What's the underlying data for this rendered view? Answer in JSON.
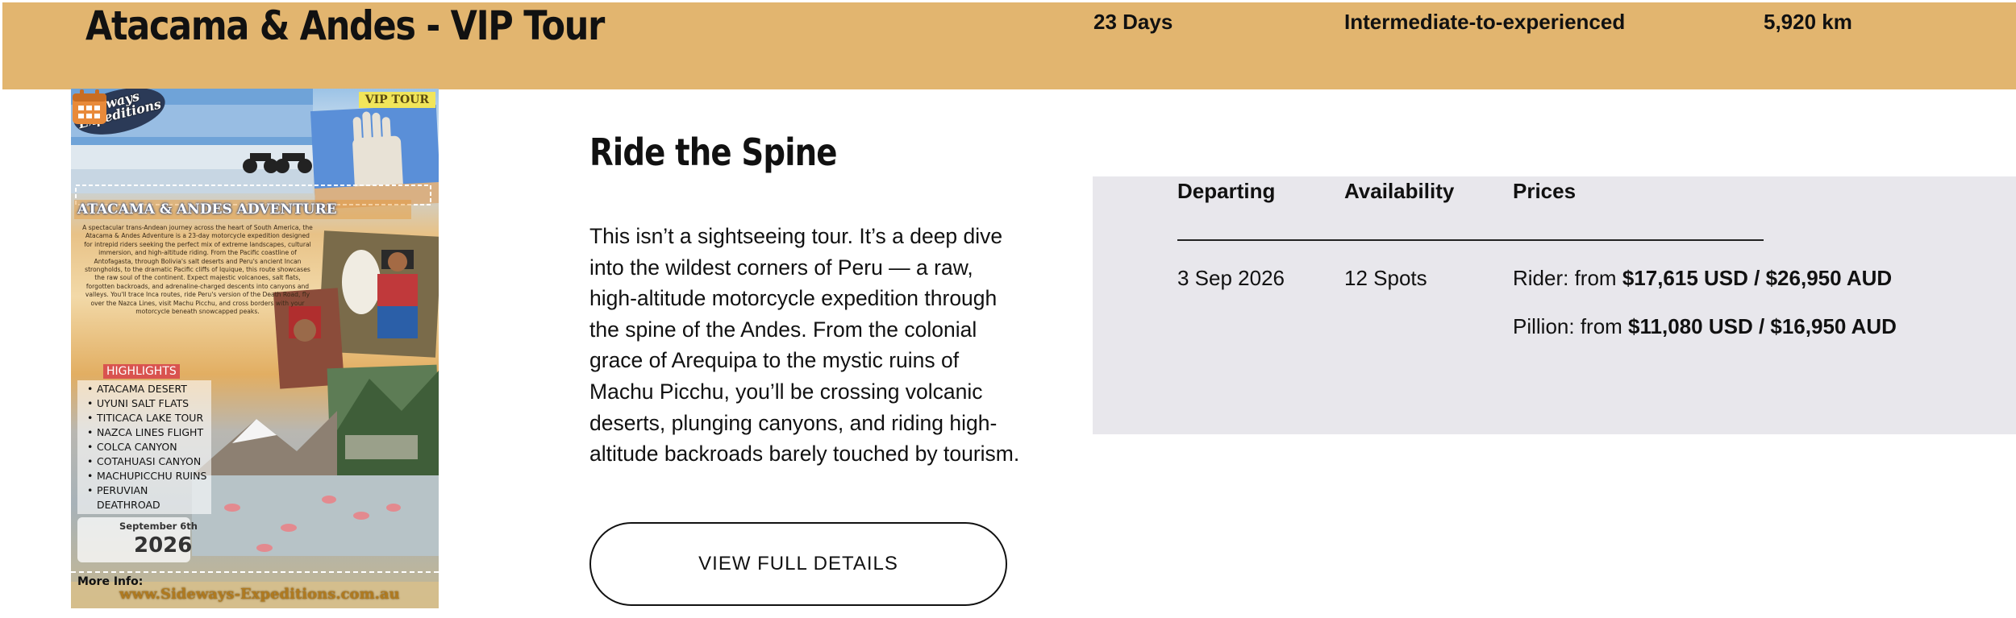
{
  "header": {
    "title": "Atacama & Andes - VIP Tour",
    "duration": "23 Days",
    "level": "Intermediate-to-experienced",
    "distance": "5,920 km"
  },
  "poster": {
    "logo_line1": "Sideways",
    "logo_line2": "Expeditions",
    "badge": "VIP TOUR",
    "banner": "ATACAMA & ANDES ADVENTURE",
    "description": "A spectacular trans-Andean journey across the heart of South America, the Atacama & Andes Adventure is a 23-day motorcycle expedition designed for intrepid riders seeking the perfect mix of extreme landscapes, cultural immersion, and high-altitude riding. From the Pacific coastline of Antofagasta, through Bolivia's salt deserts and Peru's ancient Incan strongholds, to the dramatic Pacific cliffs of Iquique, this route showcases the raw soul of the continent. Expect majestic volcanoes, salt flats, forgotten backroads, and adrenaline-charged descents into canyons and valleys. You'll trace Inca routes, ride Peru's version of the Death Road, fly over the Nazca Lines, visit Machu Picchu, and cross borders with your motorcycle beneath snowcapped peaks.",
    "highlights_heading": "HIGHLIGHTS",
    "highlights": [
      "ATACAMA DESERT",
      "UYUNI SALT FLATS",
      "TITICACA LAKE TOUR",
      "NAZCA LINES FLIGHT",
      "COLCA CANYON",
      "COTAHUASI CANYON",
      "MACHUPICCHU RUINS",
      "PERUVIAN DEATHROAD"
    ],
    "date_month": "September 6th",
    "date_year": "2026",
    "more_info": "More Info:",
    "url": "www.Sideways-Expeditions.com.au"
  },
  "main": {
    "section_title": "Ride the Spine",
    "description": "This isn’t a sightseeing tour. It’s a deep dive into the wildest corners of Peru — a raw, high-altitude motorcycle expedition through the spine of the Andes. From the colonial grace of Arequipa to the mystic ruins of Machu Picchu, you’ll be crossing volcanic deserts, plunging canyons, and riding high-altitude backroads barely touched by tourism.",
    "button_label": "VIEW FULL DETAILS"
  },
  "departures": {
    "columns": [
      "Departing",
      "Availability",
      "Prices"
    ],
    "rows": [
      {
        "departing": "3 Sep 2026",
        "availability": "12 Spots",
        "rider_label": "Rider: from ",
        "rider_price": "$17,615 USD / $26,950 AUD",
        "pillion_label": "Pillion: from ",
        "pillion_price": "$11,080 USD / $16,950 AUD"
      }
    ]
  },
  "colors": {
    "header_bar": "#e2b56f",
    "panel_bg": "#e8e7ec",
    "text": "#111111"
  }
}
